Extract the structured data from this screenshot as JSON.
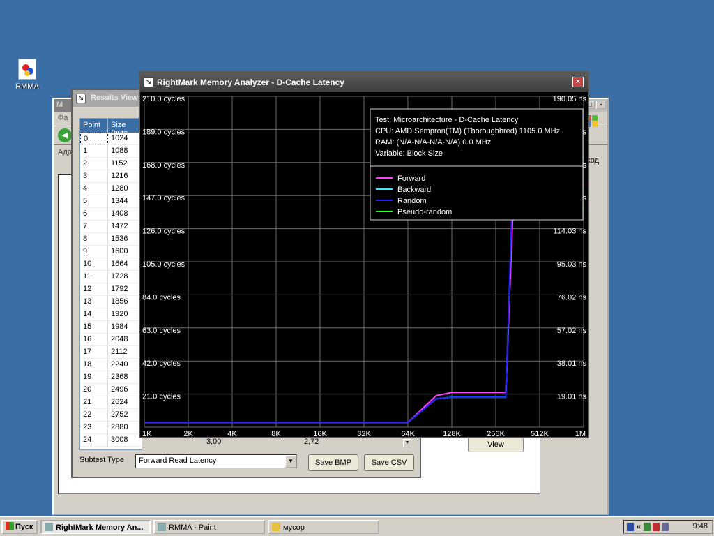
{
  "desktop": {
    "icon_label": "RMMA"
  },
  "back_window": {
    "title": "М",
    "menu_first": "Фа",
    "address_label": "Адр",
    "goto_label": "ход",
    "view_button": "View",
    "minimize": "_",
    "maximize": "□",
    "close": "×"
  },
  "results_window": {
    "title": "Results View",
    "columns": [
      "Point",
      "Size (byte"
    ],
    "rows": [
      [
        "0",
        "1024"
      ],
      [
        "1",
        "1088"
      ],
      [
        "2",
        "1152"
      ],
      [
        "3",
        "1216"
      ],
      [
        "4",
        "1280"
      ],
      [
        "5",
        "1344"
      ],
      [
        "6",
        "1408"
      ],
      [
        "7",
        "1472"
      ],
      [
        "8",
        "1536"
      ],
      [
        "9",
        "1600"
      ],
      [
        "10",
        "1664"
      ],
      [
        "11",
        "1728"
      ],
      [
        "12",
        "1792"
      ],
      [
        "13",
        "1856"
      ],
      [
        "14",
        "1920"
      ],
      [
        "15",
        "1984"
      ],
      [
        "16",
        "2048"
      ],
      [
        "17",
        "2112"
      ],
      [
        "18",
        "2240"
      ],
      [
        "19",
        "2368"
      ],
      [
        "20",
        "2496"
      ],
      [
        "21",
        "2624"
      ],
      [
        "22",
        "2752"
      ],
      [
        "23",
        "2880"
      ],
      [
        "24",
        "3008"
      ]
    ],
    "hidden_values": [
      "3,00",
      "2,72"
    ],
    "subtest_label": "Subtest Type",
    "subtest_value": "Forward Read Latency",
    "save_bmp": "Save BMP",
    "save_csv": "Save CSV"
  },
  "main_window": {
    "title": "RightMark Memory Analyzer - D-Cache Latency",
    "close": "×",
    "info": {
      "test": "Test: Microarchitecture - D-Cache Latency",
      "cpu": "CPU: AMD Sempron(TM) (Thoroughbred) 1105.0 MHz",
      "ram": "RAM:  (N/A-N/A-N/A-N/A) 0.0 MHz",
      "variable": "Variable: Block Size"
    }
  },
  "chart_data": {
    "type": "line",
    "title": "",
    "x_scale": "log2",
    "x_ticks": [
      "1K",
      "2K",
      "4K",
      "8K",
      "16K",
      "32K",
      "64K",
      "128K",
      "256K",
      "512K",
      "1M"
    ],
    "y_left_ticks": [
      "21.0 cycles",
      "42.0 cycles",
      "63.0 cycles",
      "84.0 cycles",
      "105.0 cycles",
      "126.0 cycles",
      "147.0 cycles",
      "168.0 cycles",
      "189.0 cycles",
      "210.0 cycles"
    ],
    "y_right_ticks": [
      "19.01 ns",
      "38.01 ns",
      "57.02 ns",
      "76.02 ns",
      "95.03 ns",
      "114.03 ns",
      "133.04 ns",
      "152.04 ns",
      "171.05 ns",
      "190.05 ns"
    ],
    "ylim": [
      0,
      210
    ],
    "grid": true,
    "legend_placement": "top-right",
    "series": [
      {
        "name": "Forward",
        "color": "#ff40ff",
        "points": [
          [
            1,
            3
          ],
          [
            64,
            3
          ],
          [
            100,
            20
          ],
          [
            128,
            22
          ],
          [
            256,
            22
          ],
          [
            300,
            22
          ],
          [
            340,
            150
          ],
          [
            400,
            153
          ],
          [
            1024,
            154
          ]
        ]
      },
      {
        "name": "Backward",
        "color": "#40e8ff",
        "points": [
          [
            1,
            3
          ],
          [
            64,
            3
          ],
          [
            100,
            18
          ],
          [
            128,
            19
          ],
          [
            256,
            19
          ],
          [
            300,
            19
          ],
          [
            340,
            165
          ],
          [
            380,
            171
          ],
          [
            1024,
            171
          ]
        ]
      },
      {
        "name": "Random",
        "color": "#2020ff",
        "points": [
          [
            1,
            3
          ],
          [
            64,
            3
          ],
          [
            100,
            18
          ],
          [
            128,
            19
          ],
          [
            256,
            19
          ],
          [
            300,
            19
          ],
          [
            340,
            175
          ],
          [
            360,
            192
          ],
          [
            420,
            197
          ],
          [
            1024,
            197
          ]
        ]
      },
      {
        "name": "Pseudo-random",
        "color": "#30ff30",
        "points": [
          [
            1,
            3
          ],
          [
            64,
            3
          ],
          [
            100,
            18
          ],
          [
            128,
            19
          ],
          [
            256,
            19
          ],
          [
            300,
            19
          ],
          [
            330,
            130
          ],
          [
            360,
            137
          ],
          [
            420,
            138
          ],
          [
            1024,
            139
          ]
        ]
      }
    ]
  },
  "taskbar": {
    "start": "Пуск",
    "tasks": [
      "RightMark Memory An...",
      "RMMA - Paint",
      "мусор"
    ],
    "tray_arrow": "«",
    "clock": "9:48"
  }
}
